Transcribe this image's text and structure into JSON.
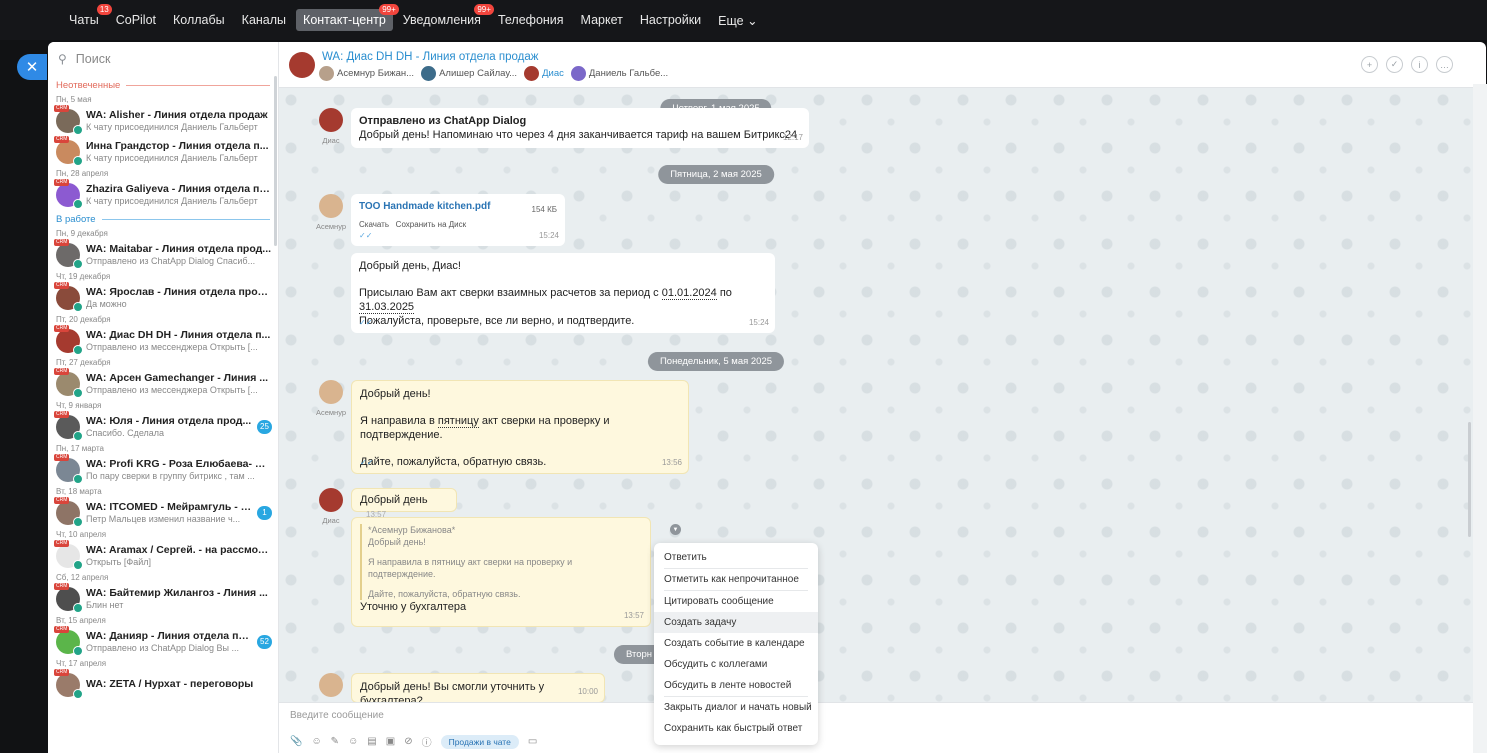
{
  "topnav": [
    {
      "label": "Чаты",
      "badge": "13",
      "active": false
    },
    {
      "label": "CoPilot",
      "badge": "",
      "active": false
    },
    {
      "label": "Коллабы",
      "badge": "",
      "active": false
    },
    {
      "label": "Каналы",
      "badge": "",
      "active": false
    },
    {
      "label": "Контакт-центр",
      "badge": "99+",
      "active": true
    },
    {
      "label": "Уведомления",
      "badge": "99+",
      "active": false
    },
    {
      "label": "Телефония",
      "badge": "",
      "active": false
    },
    {
      "label": "Маркет",
      "badge": "",
      "active": false
    },
    {
      "label": "Настройки",
      "badge": "",
      "active": false
    },
    {
      "label": "Еще ⌄",
      "badge": "",
      "active": false
    }
  ],
  "close_glyph": "✕",
  "search": {
    "placeholder": "Поиск"
  },
  "sections": {
    "unanswered": "Неотвеченные",
    "work": "В работе"
  },
  "chats_unanswered": [
    {
      "date": "Пн, 5 мая",
      "title": "WA: Alisher - Линия отдела продаж",
      "sub": "К чату присоединился Даниель Гальберт",
      "counter": "",
      "ava": "#7a6a5a"
    },
    {
      "date": "",
      "title": "Инна Грандстор - Линия отдела п...",
      "sub": "К чату присоединился Даниель Гальберт",
      "counter": "",
      "ava": "#c98a5f"
    },
    {
      "date": "Пн, 28 апреля",
      "title": "Zhazira Galiyeva - Линия отдела пр...",
      "sub": "К чату присоединился Даниель Гальберт",
      "counter": "",
      "ava": "#8c5ad1"
    }
  ],
  "chats_work": [
    {
      "date": "Пн, 9 декабря",
      "title": "WA: Maitabar - Линия отдела прод...",
      "sub": "Отправлено из ChatApp Dialog Спасиб...",
      "counter": "",
      "ava": "#6d6a69"
    },
    {
      "date": "Чт, 19 декабря",
      "title": "WA: Ярослав - Линия отдела прод...",
      "sub": "Да можно",
      "counter": "",
      "ava": "#8a4b3b"
    },
    {
      "date": "Пт, 20 декабря",
      "title": "WA: Диас DH DH - Линия отдела п...",
      "sub": "Отправлено из мессенджера Открыть [...",
      "counter": "",
      "ava": "#a53a2f"
    },
    {
      "date": "Пт, 27 декабря",
      "title": "WA: Арсен Gamechanger - Линия ...",
      "sub": "Отправлено из мессенджера Открыть [...",
      "counter": "",
      "ava": "#9b8a6e"
    },
    {
      "date": "Чт, 9 января",
      "title": "WA: Юля - Линия отдела прод...",
      "sub": "Спасибо. Сделала",
      "counter": "25",
      "ava": "#5a5a5a"
    },
    {
      "date": "Пн, 17 марта",
      "title": "WA: Profi KRG - Роза Елюбаева- де...",
      "sub": "По пару сверки в группу битрикс , там ...",
      "counter": "",
      "ava": "#7b8794"
    },
    {
      "date": "Вт, 18 марта",
      "title": "WA: ITCOMED - Мейрамгуль - д...",
      "sub": "Петр Мальцев изменил название ч...",
      "counter": "1",
      "ava": "#8e7466"
    },
    {
      "date": "Чт, 10 апреля",
      "title": "WA: Aramax / Сергей. - на рассмотр...",
      "sub": "Открыть [Файл]",
      "counter": "",
      "ava": "#e6e6e6"
    },
    {
      "date": "Сб, 12 апреля",
      "title": "WA: Байтемир Жилангоз - Линия ...",
      "sub": "Блин нет",
      "counter": "",
      "ava": "#4e4e4e"
    },
    {
      "date": "Вт, 15 апреля",
      "title": "WA: Данияр - Линия отдела пр...",
      "sub": "Отправлено из ChatApp Dialog Вы ...",
      "counter": "52",
      "ava": "#5bb54a"
    },
    {
      "date": "Чт, 17 апреля",
      "title": "WA: ZETA / Нурхат - переговоры",
      "sub": "",
      "counter": "",
      "ava": "#9a7b6a"
    }
  ],
  "crm_badge": "CRM",
  "header": {
    "title": "WA: Диас DH DH - Линия отдела продаж",
    "members": [
      "Асемнур Бижан...",
      "Алишер Сайлау...",
      "Диас",
      "Даниель Гальбе..."
    ],
    "tools": [
      "+",
      "✓",
      "i",
      "…"
    ]
  },
  "date_pills": [
    "Четверг, 1 мая 2025",
    "Пятница, 2 мая 2025",
    "Понедельник, 5 мая 2025",
    "Вторн"
  ],
  "messages": {
    "m1": {
      "title": "Отправлено из ChatApp Dialog",
      "text": "Добрый день! Напоминаю что через 4 дня заканчивается тариф на вашем Битрикс24",
      "time": "12:17",
      "author": "Диас"
    },
    "m2": {
      "file": "ТОО Handmade kitchen.pdf",
      "size": "154 КБ",
      "download": "Скачать",
      "save": "Сохранить на Диск",
      "time": "15:24",
      "author": "Асемнур"
    },
    "m3": {
      "line1": "Добрый день, Диас!",
      "line2_a": "Присылаю Вам акт сверки взаимных расчетов за период с ",
      "line2_d1": "01.01.2024",
      "line2_b": " по ",
      "line2_d2": "31.03.2025",
      "line3": "Пожалуйста, проверьте, все ли верно, и подтвердите.",
      "time": "15:24"
    },
    "m4": {
      "line1": "Добрый день!",
      "line2_a": "Я направила в ",
      "line2_u": "пятницу",
      "line2_b": " акт сверки на проверку и подтверждение.",
      "line3": "Дайте, пожалуйста, обратную связь.",
      "time": "13:56",
      "author": "Асемнур"
    },
    "m5": {
      "text": "Добрый день",
      "time": "13:57",
      "author": "Диас"
    },
    "m6": {
      "q1": "*Асемнур Бижанова*",
      "q2": "Добрый день!",
      "q3": "Я направила в пятницу акт сверки на проверку и",
      "q4": "подтверждение.",
      "q5": "Дайте, пожалуйста, обратную связь.",
      "text": "Уточню у бухгалтера",
      "time": "13:57"
    },
    "m7": {
      "text": "Добрый день! Вы смогли уточнить у бухгалтера?",
      "time": "10:00"
    }
  },
  "context_menu": [
    "Ответить",
    "Отметить как непрочитанное",
    "Цитировать сообщение",
    "Создать задачу",
    "Создать событие в календаре",
    "Обсудить с коллегами",
    "Обсудить в ленте новостей",
    "Закрыть диалог и начать новый",
    "Сохранить как быстрый ответ"
  ],
  "input": {
    "placeholder": "Введите сообщение",
    "sales": "Продажи в чате"
  },
  "colors": {
    "accent": "#2a8ecf",
    "badge": "#f2453d",
    "yellow_msg": "#fef8de"
  }
}
